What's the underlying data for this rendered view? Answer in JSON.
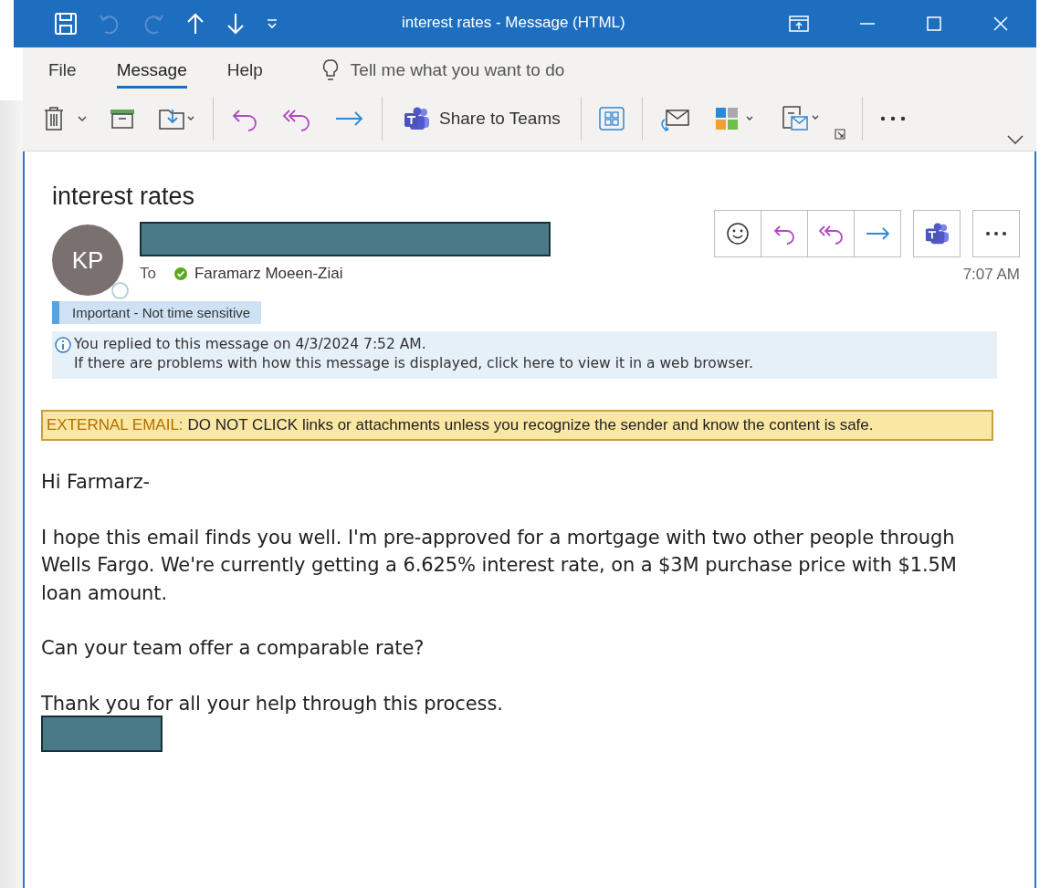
{
  "window": {
    "title": "interest rates  -  Message (HTML)"
  },
  "ribbon": {
    "tabs": [
      {
        "label": "File",
        "selected": false
      },
      {
        "label": "Message",
        "selected": true
      },
      {
        "label": "Help",
        "selected": false
      }
    ],
    "tell_me": {
      "placeholder": "Tell me what you want to do"
    },
    "share_to_teams": "Share to Teams"
  },
  "message": {
    "subject": "interest rates",
    "avatar_initials": "KP",
    "to_label": "To",
    "recipient": "Faramarz Moeen-Ziai",
    "time": "7:07 AM",
    "importance": "Important - Not time sensitive",
    "info_lines": [
      "You replied to this message on 4/3/2024 7:52 AM.",
      "If there are problems with how this message is displayed, click here to view it in a web browser."
    ],
    "external_banner": {
      "label": "EXTERNAL EMAIL:",
      "text": "DO NOT CLICK links or attachments unless you recognize the sender and know the content is safe."
    },
    "body": [
      "Hi Farmarz-",
      "I hope this email finds you well. I'm pre-approved for a mortgage with two other people through Wells Fargo. We're currently getting a 6.625% interest rate, on a $3M purchase price with $1.5M loan amount.",
      "Can your team offer a comparable rate?",
      "Thank you for all your help through this process."
    ]
  }
}
